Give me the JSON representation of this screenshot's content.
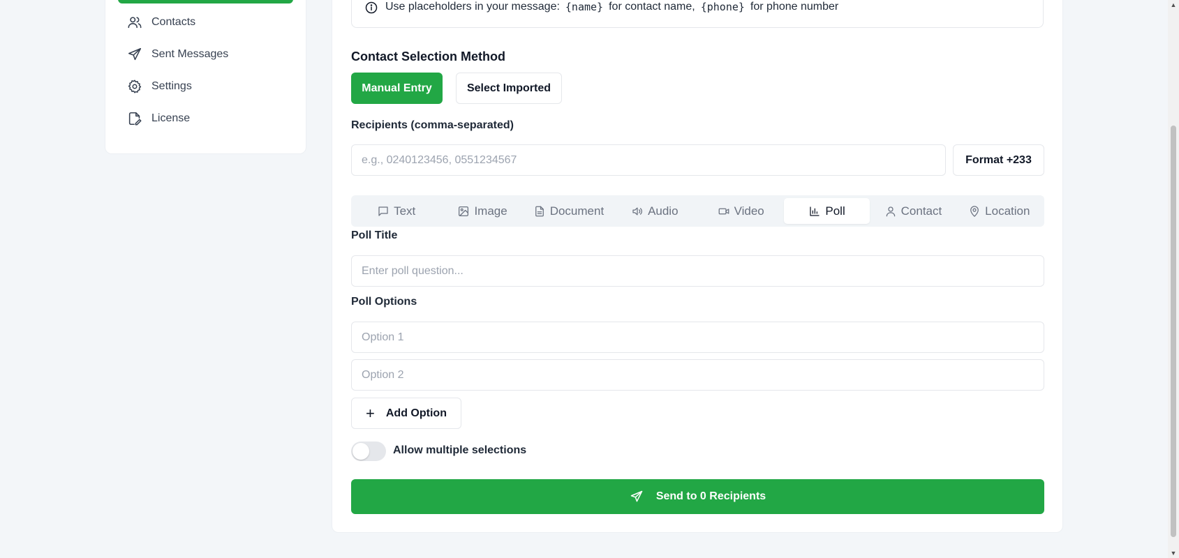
{
  "sidebar": {
    "items": [
      {
        "label": "Contacts",
        "icon": "users-icon"
      },
      {
        "label": "Sent Messages",
        "icon": "send-icon"
      },
      {
        "label": "Settings",
        "icon": "gear-icon"
      },
      {
        "label": "License",
        "icon": "license-edit-icon"
      }
    ]
  },
  "info": {
    "prefix": "Use placeholders in your message:",
    "name_code": "{name}",
    "name_desc": "for contact name,",
    "phone_code": "{phone}",
    "phone_desc": "for phone number"
  },
  "contact_selection": {
    "title": "Contact Selection Method",
    "manual_label": "Manual Entry",
    "imported_label": "Select Imported"
  },
  "recipients": {
    "label": "Recipients (comma-separated)",
    "placeholder": "e.g., 0240123456, 0551234567",
    "format_label": "Format +233"
  },
  "tabs": [
    {
      "label": "Text",
      "icon": "message-icon"
    },
    {
      "label": "Image",
      "icon": "image-icon"
    },
    {
      "label": "Document",
      "icon": "document-icon"
    },
    {
      "label": "Audio",
      "icon": "speaker-icon"
    },
    {
      "label": "Video",
      "icon": "video-icon"
    },
    {
      "label": "Poll",
      "icon": "bar-chart-icon",
      "active": true
    },
    {
      "label": "Contact",
      "icon": "user-icon"
    },
    {
      "label": "Location",
      "icon": "map-pin-icon"
    }
  ],
  "poll": {
    "title_label": "Poll Title",
    "title_placeholder": "Enter poll question...",
    "options_label": "Poll Options",
    "option1_placeholder": "Option 1",
    "option2_placeholder": "Option 2",
    "add_option_label": "Add Option",
    "multiple_label": "Allow multiple selections"
  },
  "send": {
    "label": "Send to 0 Recipients"
  },
  "colors": {
    "accent": "#22a745",
    "background": "#f3f6f9"
  }
}
